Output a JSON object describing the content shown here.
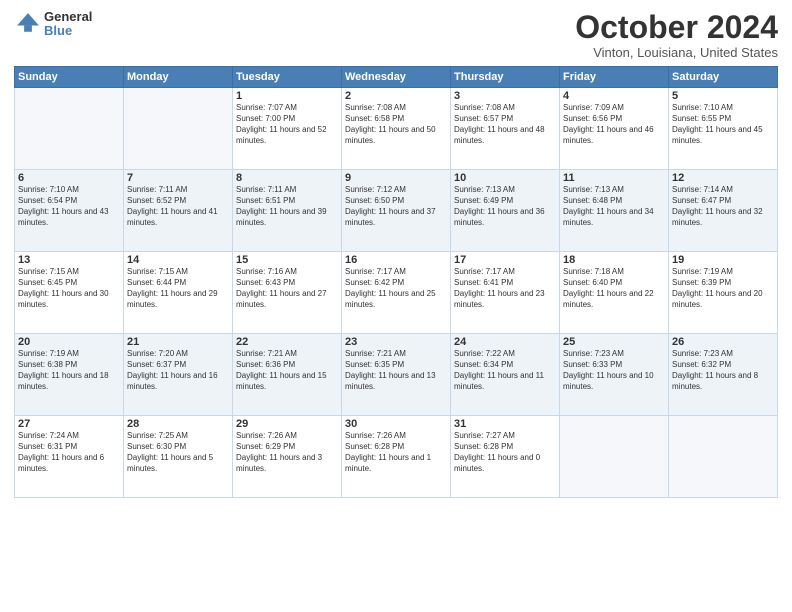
{
  "logo": {
    "general": "General",
    "blue": "Blue"
  },
  "title": "October 2024",
  "location": "Vinton, Louisiana, United States",
  "days_header": [
    "Sunday",
    "Monday",
    "Tuesday",
    "Wednesday",
    "Thursday",
    "Friday",
    "Saturday"
  ],
  "weeks": [
    [
      {
        "day": "",
        "sunrise": "",
        "sunset": "",
        "daylight": ""
      },
      {
        "day": "",
        "sunrise": "",
        "sunset": "",
        "daylight": ""
      },
      {
        "day": "1",
        "sunrise": "Sunrise: 7:07 AM",
        "sunset": "Sunset: 7:00 PM",
        "daylight": "Daylight: 11 hours and 52 minutes."
      },
      {
        "day": "2",
        "sunrise": "Sunrise: 7:08 AM",
        "sunset": "Sunset: 6:58 PM",
        "daylight": "Daylight: 11 hours and 50 minutes."
      },
      {
        "day": "3",
        "sunrise": "Sunrise: 7:08 AM",
        "sunset": "Sunset: 6:57 PM",
        "daylight": "Daylight: 11 hours and 48 minutes."
      },
      {
        "day": "4",
        "sunrise": "Sunrise: 7:09 AM",
        "sunset": "Sunset: 6:56 PM",
        "daylight": "Daylight: 11 hours and 46 minutes."
      },
      {
        "day": "5",
        "sunrise": "Sunrise: 7:10 AM",
        "sunset": "Sunset: 6:55 PM",
        "daylight": "Daylight: 11 hours and 45 minutes."
      }
    ],
    [
      {
        "day": "6",
        "sunrise": "Sunrise: 7:10 AM",
        "sunset": "Sunset: 6:54 PM",
        "daylight": "Daylight: 11 hours and 43 minutes."
      },
      {
        "day": "7",
        "sunrise": "Sunrise: 7:11 AM",
        "sunset": "Sunset: 6:52 PM",
        "daylight": "Daylight: 11 hours and 41 minutes."
      },
      {
        "day": "8",
        "sunrise": "Sunrise: 7:11 AM",
        "sunset": "Sunset: 6:51 PM",
        "daylight": "Daylight: 11 hours and 39 minutes."
      },
      {
        "day": "9",
        "sunrise": "Sunrise: 7:12 AM",
        "sunset": "Sunset: 6:50 PM",
        "daylight": "Daylight: 11 hours and 37 minutes."
      },
      {
        "day": "10",
        "sunrise": "Sunrise: 7:13 AM",
        "sunset": "Sunset: 6:49 PM",
        "daylight": "Daylight: 11 hours and 36 minutes."
      },
      {
        "day": "11",
        "sunrise": "Sunrise: 7:13 AM",
        "sunset": "Sunset: 6:48 PM",
        "daylight": "Daylight: 11 hours and 34 minutes."
      },
      {
        "day": "12",
        "sunrise": "Sunrise: 7:14 AM",
        "sunset": "Sunset: 6:47 PM",
        "daylight": "Daylight: 11 hours and 32 minutes."
      }
    ],
    [
      {
        "day": "13",
        "sunrise": "Sunrise: 7:15 AM",
        "sunset": "Sunset: 6:45 PM",
        "daylight": "Daylight: 11 hours and 30 minutes."
      },
      {
        "day": "14",
        "sunrise": "Sunrise: 7:15 AM",
        "sunset": "Sunset: 6:44 PM",
        "daylight": "Daylight: 11 hours and 29 minutes."
      },
      {
        "day": "15",
        "sunrise": "Sunrise: 7:16 AM",
        "sunset": "Sunset: 6:43 PM",
        "daylight": "Daylight: 11 hours and 27 minutes."
      },
      {
        "day": "16",
        "sunrise": "Sunrise: 7:17 AM",
        "sunset": "Sunset: 6:42 PM",
        "daylight": "Daylight: 11 hours and 25 minutes."
      },
      {
        "day": "17",
        "sunrise": "Sunrise: 7:17 AM",
        "sunset": "Sunset: 6:41 PM",
        "daylight": "Daylight: 11 hours and 23 minutes."
      },
      {
        "day": "18",
        "sunrise": "Sunrise: 7:18 AM",
        "sunset": "Sunset: 6:40 PM",
        "daylight": "Daylight: 11 hours and 22 minutes."
      },
      {
        "day": "19",
        "sunrise": "Sunrise: 7:19 AM",
        "sunset": "Sunset: 6:39 PM",
        "daylight": "Daylight: 11 hours and 20 minutes."
      }
    ],
    [
      {
        "day": "20",
        "sunrise": "Sunrise: 7:19 AM",
        "sunset": "Sunset: 6:38 PM",
        "daylight": "Daylight: 11 hours and 18 minutes."
      },
      {
        "day": "21",
        "sunrise": "Sunrise: 7:20 AM",
        "sunset": "Sunset: 6:37 PM",
        "daylight": "Daylight: 11 hours and 16 minutes."
      },
      {
        "day": "22",
        "sunrise": "Sunrise: 7:21 AM",
        "sunset": "Sunset: 6:36 PM",
        "daylight": "Daylight: 11 hours and 15 minutes."
      },
      {
        "day": "23",
        "sunrise": "Sunrise: 7:21 AM",
        "sunset": "Sunset: 6:35 PM",
        "daylight": "Daylight: 11 hours and 13 minutes."
      },
      {
        "day": "24",
        "sunrise": "Sunrise: 7:22 AM",
        "sunset": "Sunset: 6:34 PM",
        "daylight": "Daylight: 11 hours and 11 minutes."
      },
      {
        "day": "25",
        "sunrise": "Sunrise: 7:23 AM",
        "sunset": "Sunset: 6:33 PM",
        "daylight": "Daylight: 11 hours and 10 minutes."
      },
      {
        "day": "26",
        "sunrise": "Sunrise: 7:23 AM",
        "sunset": "Sunset: 6:32 PM",
        "daylight": "Daylight: 11 hours and 8 minutes."
      }
    ],
    [
      {
        "day": "27",
        "sunrise": "Sunrise: 7:24 AM",
        "sunset": "Sunset: 6:31 PM",
        "daylight": "Daylight: 11 hours and 6 minutes."
      },
      {
        "day": "28",
        "sunrise": "Sunrise: 7:25 AM",
        "sunset": "Sunset: 6:30 PM",
        "daylight": "Daylight: 11 hours and 5 minutes."
      },
      {
        "day": "29",
        "sunrise": "Sunrise: 7:26 AM",
        "sunset": "Sunset: 6:29 PM",
        "daylight": "Daylight: 11 hours and 3 minutes."
      },
      {
        "day": "30",
        "sunrise": "Sunrise: 7:26 AM",
        "sunset": "Sunset: 6:28 PM",
        "daylight": "Daylight: 11 hours and 1 minute."
      },
      {
        "day": "31",
        "sunrise": "Sunrise: 7:27 AM",
        "sunset": "Sunset: 6:28 PM",
        "daylight": "Daylight: 11 hours and 0 minutes."
      },
      {
        "day": "",
        "sunrise": "",
        "sunset": "",
        "daylight": ""
      },
      {
        "day": "",
        "sunrise": "",
        "sunset": "",
        "daylight": ""
      }
    ]
  ]
}
